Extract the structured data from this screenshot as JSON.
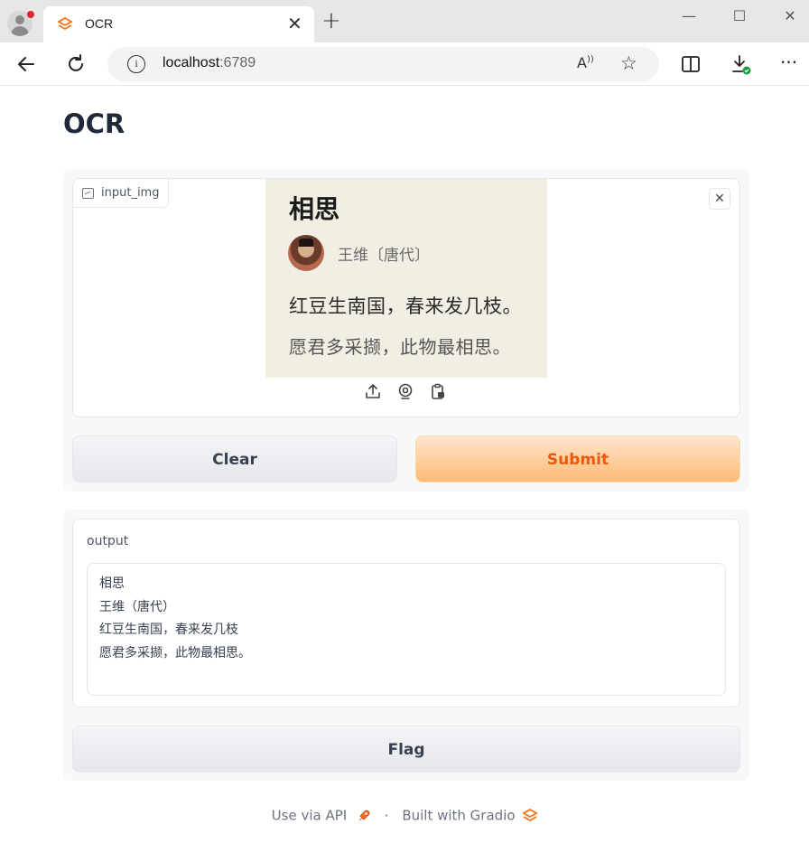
{
  "browser": {
    "tab_title": "OCR",
    "url_host": "localhost",
    "url_port": ":6789"
  },
  "app": {
    "title": "OCR"
  },
  "input": {
    "label": "input_img",
    "image_poem": {
      "title": "相思",
      "author": "王维〔唐代〕",
      "line1": "红豆生南国，春来发几枝。",
      "line2": "愿君多采撷，此物最相思。"
    }
  },
  "buttons": {
    "clear": "Clear",
    "submit": "Submit",
    "flag": "Flag"
  },
  "output": {
    "label": "output",
    "lines": [
      "相思",
      "王维（唐代）",
      "红豆生南国，春来发几枝",
      "愿君多采撷，此物最相思。"
    ]
  },
  "footer": {
    "api": "Use via API",
    "separator": "·",
    "built": "Built with Gradio"
  },
  "colors": {
    "accent": "#ea580c",
    "submit_bg": "#fdba74"
  }
}
